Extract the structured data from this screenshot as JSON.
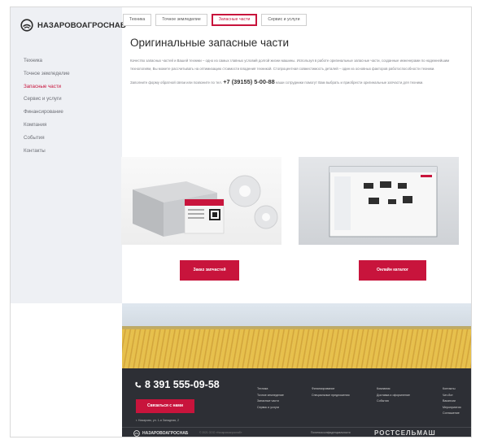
{
  "brand": {
    "name": "НАЗАРОВОАГРОСНАБ",
    "accent": "#c8143c"
  },
  "sidebar": {
    "items": [
      {
        "label": "Техника"
      },
      {
        "label": "Точное земледелие"
      },
      {
        "label": "Запасные части",
        "active": true
      },
      {
        "label": "Сервис и услуги"
      },
      {
        "label": "Финансирование"
      },
      {
        "label": "Компания"
      },
      {
        "label": "События"
      },
      {
        "label": "Контакты"
      }
    ]
  },
  "tabs": [
    {
      "label": "Техника"
    },
    {
      "label": "Точное земледелие"
    },
    {
      "label": "Запасные части",
      "active": true
    },
    {
      "label": "Сервис и услуги"
    }
  ],
  "main": {
    "title": "Оригинальные запасные части",
    "paragraph1": "Качество запасных частей и Вашей техники – одно из самых главных условий долгой жизни машины. Используя в работе оригинальные запасные части, созданные инженерами по надежнейшим технологиям, Вы можете рассчитывать на оптимизацию стоимости владения техникой. Стопроцентная совместимость деталей – один из основных факторов работоспособности техники.",
    "paragraph2_before": "Заполните форму обратной связи или позвоните по тел.",
    "phone": "+7 (39155) 5-00-88",
    "paragraph2_after": "наши сотрудники помогут Вам выбрать и приобрести оригинальные запчасти для техники."
  },
  "buttons": {
    "order": "Заказ запчастей",
    "catalog": "Онлайн каталог"
  },
  "footer": {
    "phone": "8 391 555-09-58",
    "call_button": "Связаться с нами",
    "address": "г. Назарово, ул. 1-я Западная, 2",
    "columns": [
      [
        "Техника",
        "Точное земледелие",
        "Запасные части",
        "Сервис и услуги"
      ],
      [
        "Финансирование",
        "Специальные предложения"
      ],
      [
        "Компания",
        "Доставка и оформление",
        "События"
      ],
      [
        "Контакты",
        "Чат-бот",
        "Вакансии",
        "Мероприятия",
        "Соглашение"
      ]
    ],
    "logo_text": "НАЗАРОВОАГРОСНАБ",
    "copyright": "© 2021 ООО «Назаровоагроснаб»",
    "policy": "Политика конфиденциальности",
    "partner": "РОСТСЕЛЬМАШ"
  }
}
